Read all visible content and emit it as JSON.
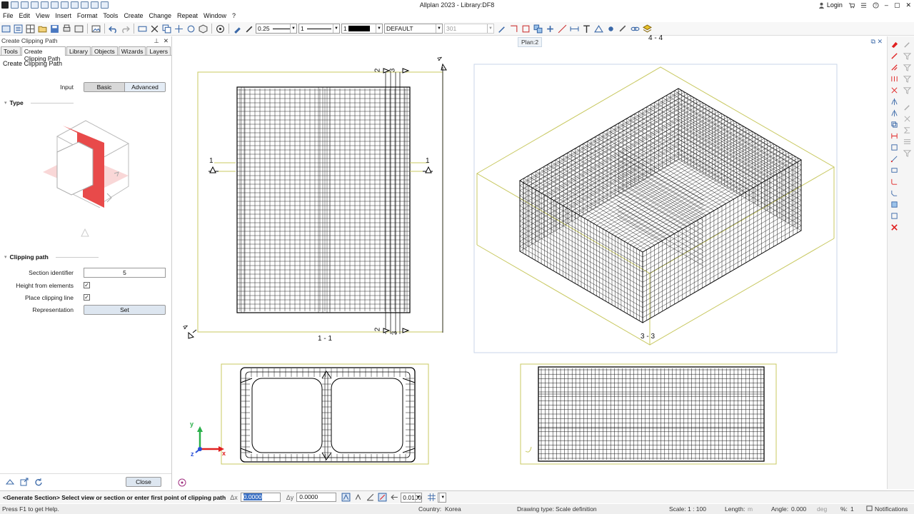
{
  "window": {
    "title": "Allplan 2023 - Library:DF8",
    "login_label": "Login"
  },
  "menu": [
    "File",
    "Edit",
    "View",
    "Insert",
    "Format",
    "Tools",
    "Create",
    "Change",
    "Repeat",
    "Window",
    "?"
  ],
  "toolbar": {
    "pen_thickness": "0.25",
    "line_type": "1",
    "color": "1",
    "layer": "DEFAULT",
    "pattern": "301"
  },
  "palette": {
    "title": "Create Clipping Path",
    "tabs": [
      "Tools",
      "Create Clipping Path",
      "Library",
      "Objects",
      "Wizards",
      "Layers"
    ],
    "active_tab": "Create Clipping Path",
    "subtitle": "Create Clipping Path",
    "input_label": "Input",
    "input_options": [
      "Basic",
      "Advanced"
    ],
    "type_header": "Type",
    "clipping_header": "Clipping path",
    "section_identifier_label": "Section identifier",
    "section_identifier_value": "5",
    "height_from_elements_label": "Height from elements",
    "height_from_elements_checked": true,
    "place_clipping_line_label": "Place clipping line",
    "place_clipping_line_checked": true,
    "representation_label": "Representation",
    "set_button": "Set",
    "close_button": "Close"
  },
  "canvas": {
    "tooltip": "Plan:2",
    "view_labels": {
      "top_4": "4 - 4",
      "plan_1": "1 - 1",
      "iso_3": "3 - 3",
      "sec_num_1": "1",
      "sec_num_2": "2",
      "sec_num_3": "3",
      "sec_num_4": "4"
    },
    "axis": {
      "x": "x",
      "y": "y",
      "z": "z"
    }
  },
  "command": {
    "prompt": "<Generate Section> Select view or section or enter first point of clipping path",
    "dx_label": "Δx",
    "dx_value": "0.0000",
    "dy_label": "Δy",
    "dy_value": "0.0000",
    "step_value": "0.0100"
  },
  "status": {
    "help": "Press F1 to get Help.",
    "country_label": "Country:",
    "country": "Korea",
    "drawing_type_label": "Drawing type:",
    "drawing_type": "Scale definition",
    "scale_label": "Scale:",
    "scale": "1 : 100",
    "length_label": "Length:",
    "length_unit": "m",
    "angle_label": "Angle:",
    "angle": "0.000",
    "angle_unit": "deg",
    "percent_label": "%:",
    "percent": "1",
    "notifications": "Notifications"
  },
  "colors": {
    "accent_red": "#e02020",
    "border_yellow": "#c8c860",
    "axis_green": "#2ab04a",
    "axis_blue": "#2850d8"
  }
}
